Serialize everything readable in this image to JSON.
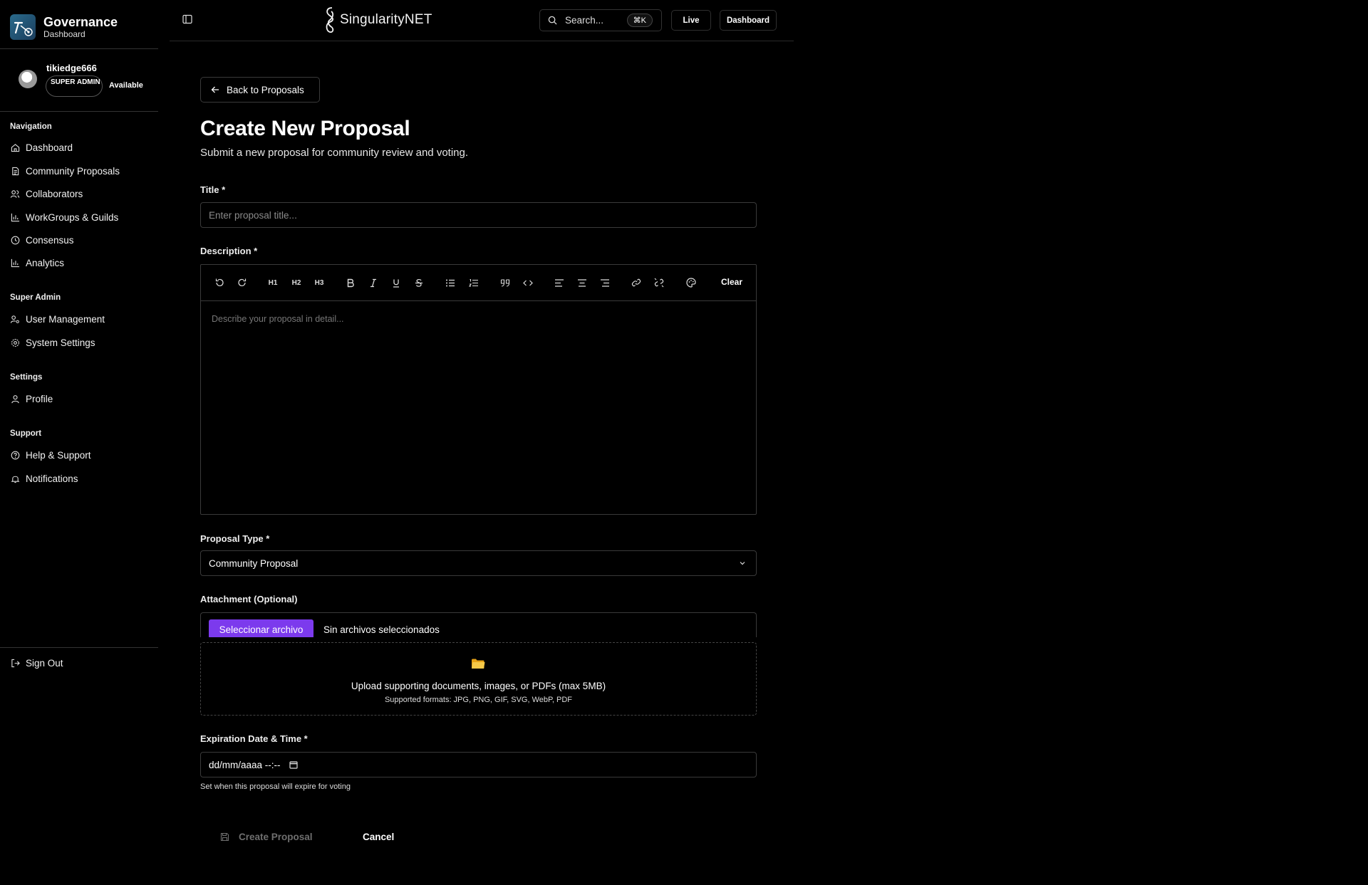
{
  "brand": {
    "title": "Governance",
    "subtitle": "Dashboard"
  },
  "user": {
    "name": "tikiedge666",
    "role": "SUPER ADMIN",
    "status": "Available"
  },
  "nav_sections": {
    "navigation": "Navigation",
    "super_admin": "Super Admin",
    "settings": "Settings",
    "support": "Support"
  },
  "nav": {
    "dashboard": "Dashboard",
    "community_proposals": "Community Proposals",
    "collaborators": "Collaborators",
    "workgroups": "WorkGroups & Guilds",
    "consensus": "Consensus",
    "analytics": "Analytics",
    "user_management": "User Management",
    "system_settings": "System Settings",
    "profile": "Profile",
    "help": "Help & Support",
    "notifications": "Notifications",
    "sign_out": "Sign Out"
  },
  "topbar": {
    "logo_text": "SingularityNET",
    "search_placeholder": "Search...",
    "search_shortcut": "⌘K",
    "live_label": "Live",
    "dashboard_label": "Dashboard"
  },
  "page": {
    "back_label": "Back to Proposals",
    "title": "Create New Proposal",
    "subtitle": "Submit a new proposal for community review and voting."
  },
  "form": {
    "title_label": "Title *",
    "title_placeholder": "Enter proposal title...",
    "description_label": "Description *",
    "description_placeholder": "Describe your proposal in detail...",
    "toolbar": {
      "h1": "H1",
      "h2": "H2",
      "h3": "H3",
      "clear": "Clear"
    },
    "type_label": "Proposal Type *",
    "type_value": "Community Proposal",
    "attachment_label": "Attachment (Optional)",
    "file_button": "Seleccionar archivo",
    "file_status": "Sin archivos seleccionados",
    "dropzone_main": "Upload supporting documents, images, or PDFs (max 5MB)",
    "dropzone_sub": "Supported formats: JPG, PNG, GIF, SVG, WebP, PDF",
    "expiration_label": "Expiration Date & Time *",
    "expiration_placeholder": "dd/mm/aaaa --:--",
    "expiration_hint": "Set when this proposal will expire for voting",
    "submit_label": "Create Proposal",
    "cancel_label": "Cancel"
  },
  "colors": {
    "background": "#000000",
    "accent": "#7c3aed",
    "border": "#3a3a3a",
    "muted": "#6f6f6f"
  },
  "icons": [
    "governance-logo-icon",
    "sidebar-toggle-icon",
    "singularitynet-logo-icon",
    "search-icon",
    "arrow-left-icon",
    "home-icon",
    "document-icon",
    "users-icon",
    "bar-chart-icon",
    "clock-icon",
    "user-cog-icon",
    "gear-icon",
    "user-icon",
    "help-circle-icon",
    "bell-icon",
    "sign-out-icon",
    "undo-icon",
    "redo-icon",
    "bold-icon",
    "italic-icon",
    "underline-icon",
    "strikethrough-icon",
    "bullet-list-icon",
    "ordered-list-icon",
    "quote-icon",
    "code-icon",
    "align-left-icon",
    "align-center-icon",
    "align-right-icon",
    "link-icon",
    "unlink-icon",
    "palette-icon",
    "chevron-down-icon",
    "folder-icon",
    "calendar-icon",
    "save-icon"
  ]
}
